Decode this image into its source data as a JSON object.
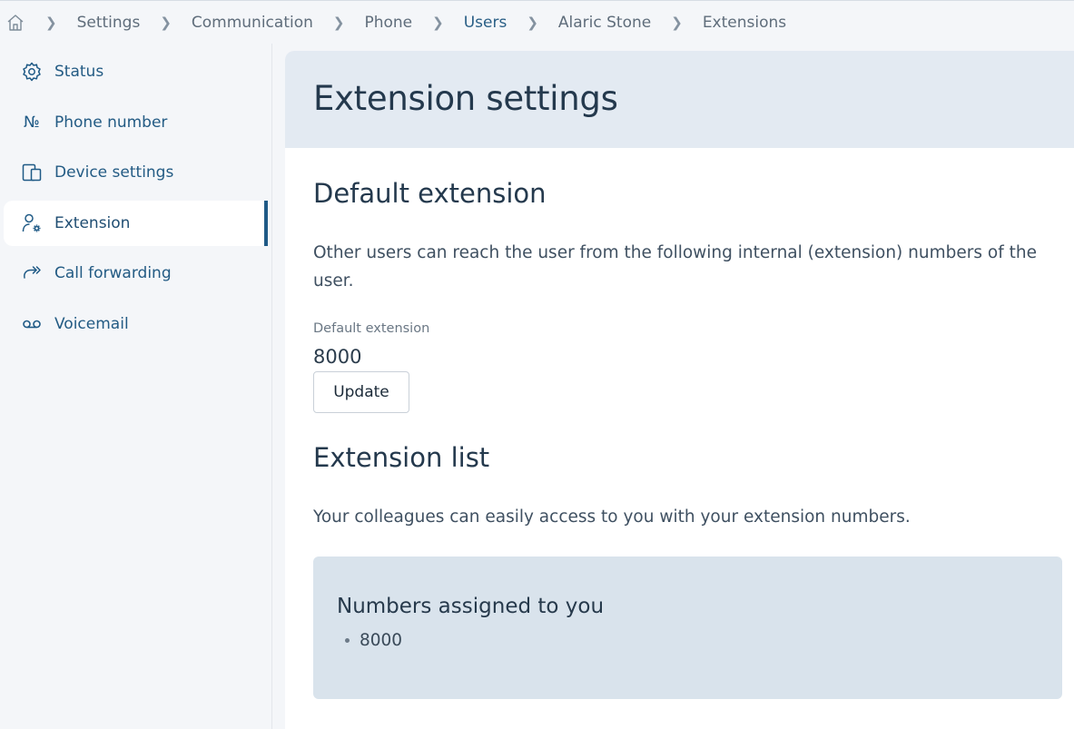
{
  "breadcrumb": {
    "items": [
      "Settings",
      "Communication",
      "Phone",
      "Users",
      "Alaric Stone",
      "Extensions"
    ]
  },
  "sidebar": {
    "items": [
      {
        "label": "Status",
        "icon": "gear-icon"
      },
      {
        "label": "Phone number",
        "icon": "numero-icon"
      },
      {
        "label": "Device settings",
        "icon": "devices-icon"
      },
      {
        "label": "Extension",
        "icon": "user-settings-icon",
        "selected": true
      },
      {
        "label": "Call forwarding",
        "icon": "call-forward-icon"
      },
      {
        "label": "Voicemail",
        "icon": "voicemail-icon"
      }
    ]
  },
  "main": {
    "title": "Extension settings",
    "default_section": {
      "title": "Default extension",
      "description": "Other users can reach the user from the following internal (extension) numbers of the user.",
      "field_label": "Default extension",
      "field_value": "8000",
      "update_label": "Update"
    },
    "list_section": {
      "title": "Extension list",
      "description": "Your colleagues can easily access to you with your extension numbers.",
      "assigned_title": "Numbers assigned to you",
      "numbers": [
        "8000"
      ]
    }
  },
  "colors": {
    "accent": "#1f5a86",
    "header_bg": "#e3eaf2",
    "assigned_bg": "#d9e3ec"
  }
}
